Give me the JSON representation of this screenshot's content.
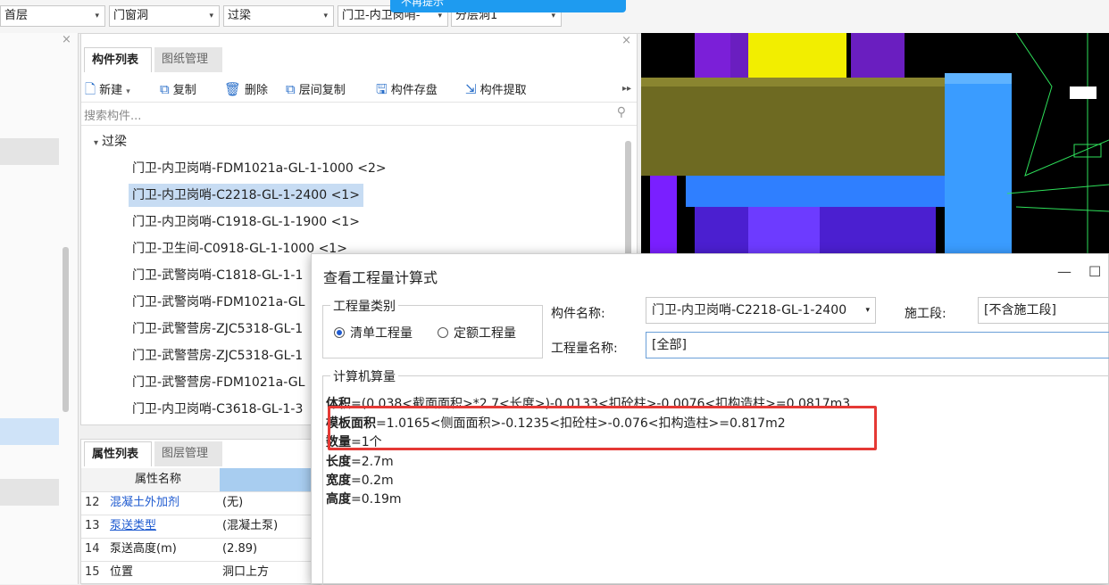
{
  "topbar": {
    "floor": "首层",
    "category": "门窗洞",
    "subcategory": "过梁",
    "component": "门卫-内卫岗哨-",
    "layer": "分层洞1",
    "popup_text": "不再提示"
  },
  "component_panel": {
    "tabs": [
      "构件列表",
      "图纸管理"
    ],
    "toolbar": [
      "新建",
      "复制",
      "删除",
      "层间复制",
      "构件存盘",
      "构件提取"
    ],
    "search_placeholder": "搜索构件...",
    "tree_root": "过梁",
    "items": [
      "门卫-内卫岗哨-FDM1021a-GL-1-1000 <2>",
      "门卫-内卫岗哨-C2218-GL-1-2400 <1>",
      "门卫-内卫岗哨-C1918-GL-1-1900 <1>",
      "门卫-卫生间-C0918-GL-1-1000 <1>",
      "门卫-武警岗哨-C1818-GL-1-1",
      "门卫-武警岗哨-FDM1021a-GL",
      "门卫-武警营房-ZJC5318-GL-1",
      "门卫-武警营房-ZJC5318-GL-1",
      "门卫-武警营房-FDM1021a-GL",
      "门卫-内卫岗哨-C3618-GL-1-3"
    ],
    "selected_index": 1
  },
  "property_panel": {
    "tabs": [
      "属性列表",
      "图层管理"
    ],
    "header": "属性名称",
    "rows": [
      {
        "num": "12",
        "name": "混凝土外加剂",
        "value": "(无)"
      },
      {
        "num": "13",
        "name": "泵送类型",
        "value": "(混凝土泵)"
      },
      {
        "num": "14",
        "name": "泵送高度(m)",
        "value": "(2.89)"
      },
      {
        "num": "15",
        "name": "位置",
        "value": "洞口上方"
      }
    ]
  },
  "dialog": {
    "title": "查看工程量计算式",
    "minimize": "—",
    "maximize": "☐",
    "quantity_type_label": "工程量类别",
    "radio_bill": "清单工程量",
    "radio_quota": "定额工程量",
    "component_name_label": "构件名称:",
    "component_name_value": "门卫-内卫岗哨-C2218-GL-1-2400",
    "stage_label": "施工段:",
    "stage_value": "[不含施工段]",
    "quantity_name_label": "工程量名称:",
    "quantity_name_value": "[全部]",
    "calc_label": "计算机算量",
    "lines": [
      {
        "key": "体积",
        "expr": "=(0.038<截面面积>*2.7<长度>)-0.0133<扣砼柱>-0.0076<扣构造柱>=0.0817m3"
      },
      {
        "key": "模板面积",
        "expr": "=1.0165<侧面面积>-0.1235<扣砼柱>-0.076<扣构造柱>=0.817m2"
      },
      {
        "key": "数量",
        "expr": "=1个"
      },
      {
        "key": "长度",
        "expr": "=2.7m"
      },
      {
        "key": "宽度",
        "expr": "=0.2m"
      },
      {
        "key": "高度",
        "expr": "=0.19m"
      }
    ]
  },
  "colors": {
    "selection": "#c7dcf3",
    "highlight_box": "#e53935",
    "accent_blue": "#1e9bf0"
  }
}
